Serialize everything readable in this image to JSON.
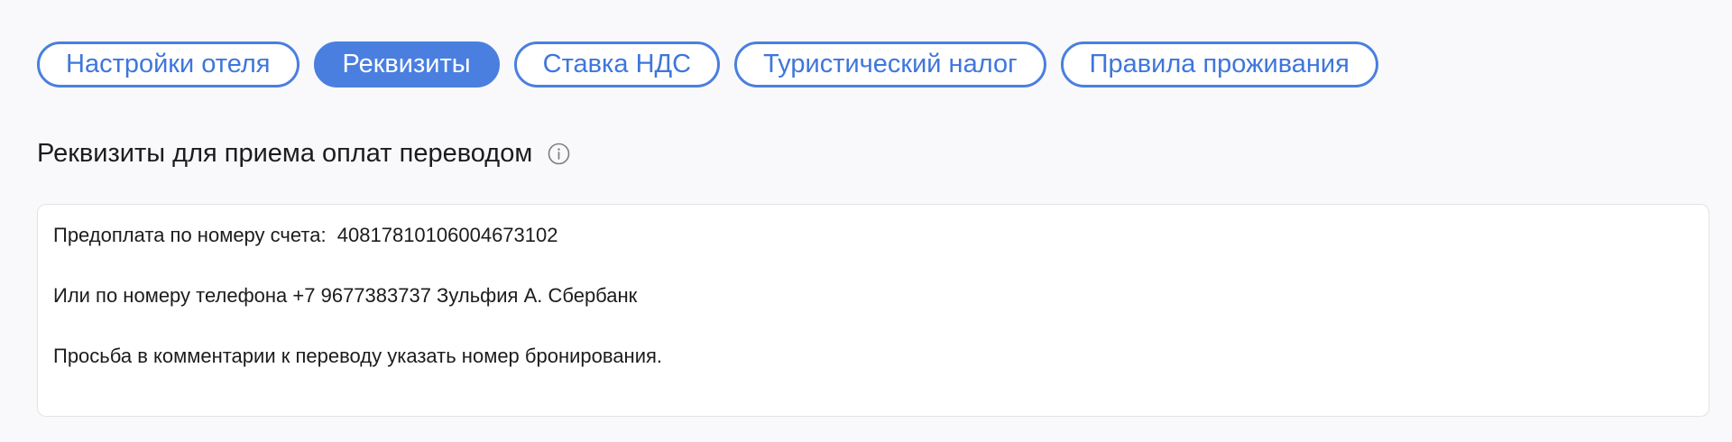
{
  "tabs": [
    {
      "label": "Настройки отеля",
      "active": false
    },
    {
      "label": "Реквизиты",
      "active": true
    },
    {
      "label": "Ставка НДС",
      "active": false
    },
    {
      "label": "Туристический налог",
      "active": false
    },
    {
      "label": "Правила проживания",
      "active": false
    }
  ],
  "section": {
    "title": "Реквизиты для приема оплат переводом",
    "info_icon": "info-circle-icon"
  },
  "payment_details": {
    "lines": [
      "Предоплата по номеру счета:  40817810106004673102",
      "Или по номеру телефона +7 9677383737 Зульфия А. Сбербанк",
      "Просьба в комментарии к переводу указать номер бронирования."
    ]
  },
  "colors": {
    "accent": "#4a7fe0",
    "background": "#f9f9fb",
    "text": "#1c1c1e",
    "border": "#e3e3e7"
  }
}
